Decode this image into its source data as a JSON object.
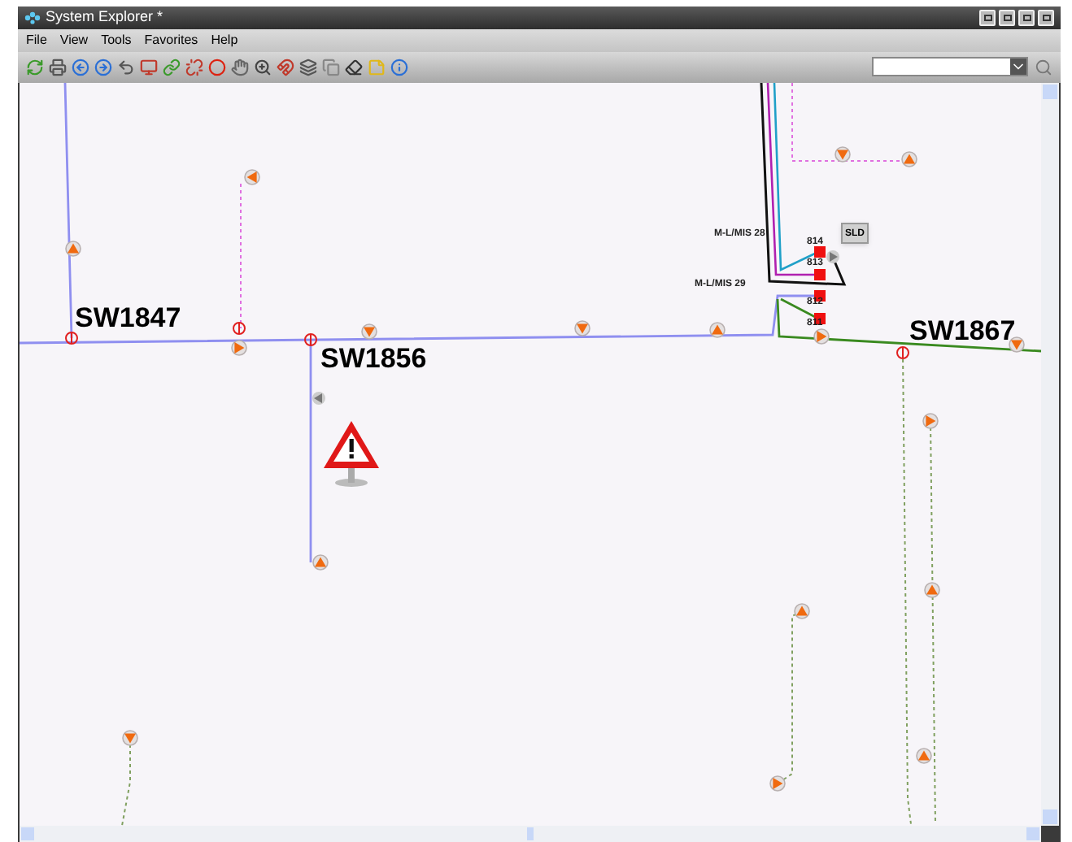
{
  "window": {
    "title": "System Explorer *"
  },
  "menu": [
    "File",
    "View",
    "Tools",
    "Favorites",
    "Help"
  ],
  "map": {
    "switch_labels": [
      {
        "text": "SW1847"
      },
      {
        "text": "SW1856"
      },
      {
        "text": "SW1867"
      }
    ],
    "line_labels": [
      {
        "text": "M-L/MIS 28"
      },
      {
        "text": "M-L/MIS 29"
      }
    ],
    "node_labels": [
      {
        "text": "814"
      },
      {
        "text": "813"
      },
      {
        "text": "812"
      },
      {
        "text": "811"
      }
    ],
    "sld_button": "SLD"
  }
}
